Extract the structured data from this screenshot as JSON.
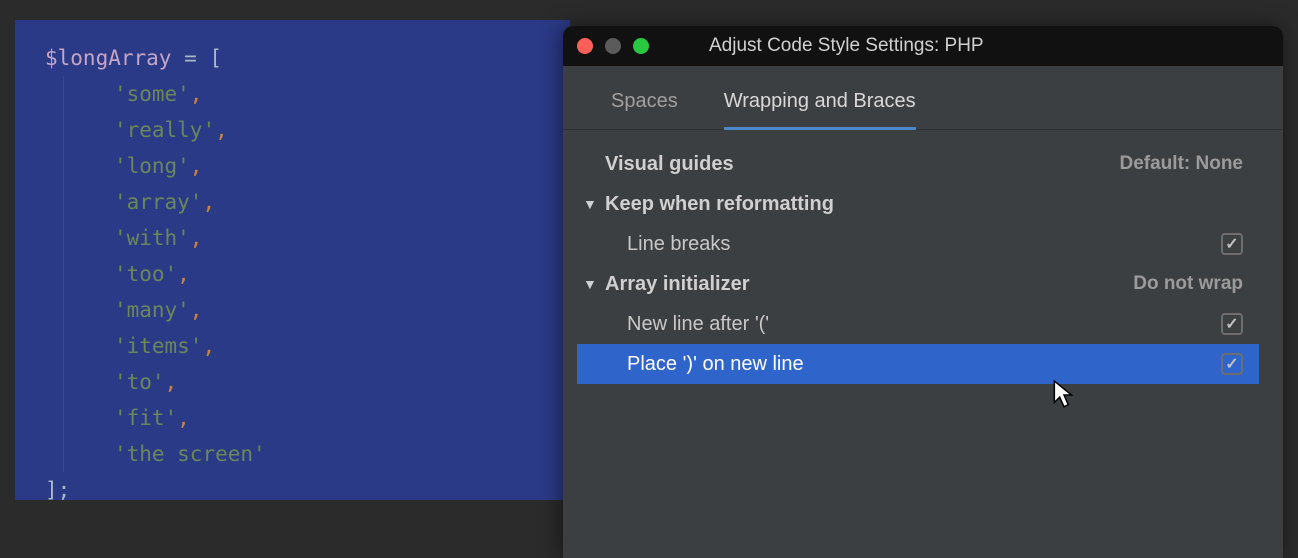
{
  "editor": {
    "variable": "$longArray",
    "assign": " = ",
    "open_bracket": "[",
    "close_bracket": "];",
    "items": [
      "some",
      "really",
      "long",
      "array",
      "with",
      "too",
      "many",
      "items",
      "to",
      "fit",
      "the screen"
    ]
  },
  "dialog": {
    "title": "Adjust Code Style Settings: PHP",
    "tabs": {
      "spaces": "Spaces",
      "wrapping": "Wrapping and Braces"
    },
    "rows": {
      "visual_guides": {
        "label": "Visual guides",
        "value": "Default: None"
      },
      "keep_reformat": {
        "label": "Keep when reformatting"
      },
      "line_breaks": {
        "label": "Line breaks",
        "checked": true
      },
      "array_init": {
        "label": "Array initializer",
        "value": "Do not wrap"
      },
      "newline_after": {
        "label": "New line after '('",
        "checked": true
      },
      "place_on_newline": {
        "label": "Place ')' on new line",
        "checked": true
      }
    }
  }
}
